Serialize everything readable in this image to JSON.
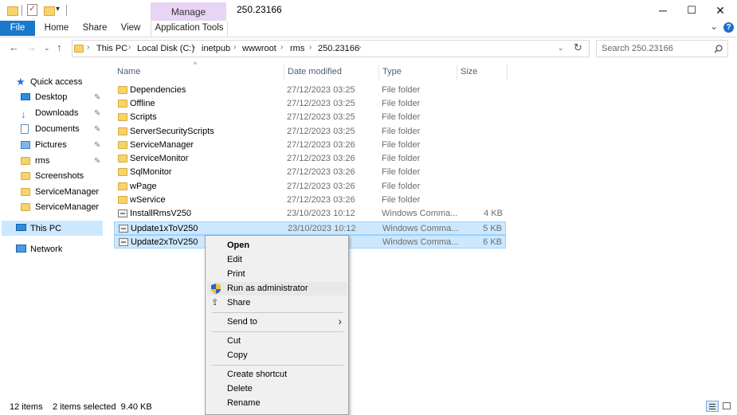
{
  "title_bar": {
    "manage_label": "Manage",
    "window_title": "250.23166",
    "minimize_glyph": "─",
    "maximize_glyph": "☐",
    "close_glyph": "✕"
  },
  "ribbon": {
    "tabs": [
      "File",
      "Home",
      "Share",
      "View",
      "Application Tools"
    ],
    "expand_glyph": "⌄",
    "help_glyph": "?"
  },
  "address_bar": {
    "breadcrumbs": [
      "This PC",
      "Local Disk (C:)",
      "inetpub",
      "wwwroot",
      "rms",
      "250.23166"
    ],
    "search_placeholder": "Search 250.23166"
  },
  "nav_pane": {
    "quick_access": "Quick access",
    "items": [
      {
        "label": "Desktop",
        "icon": "desktop-icon",
        "pinned": true
      },
      {
        "label": "Downloads",
        "icon": "download-icon",
        "pinned": true
      },
      {
        "label": "Documents",
        "icon": "documents-icon",
        "pinned": true
      },
      {
        "label": "Pictures",
        "icon": "pictures-icon",
        "pinned": true
      },
      {
        "label": "rms",
        "icon": "folder-icon",
        "pinned": true
      },
      {
        "label": "Screenshots",
        "icon": "folder-icon",
        "pinned": false
      },
      {
        "label": "ServiceManager",
        "icon": "folder-icon",
        "pinned": false
      },
      {
        "label": "ServiceManager",
        "icon": "folder-icon",
        "pinned": false
      }
    ],
    "this_pc": "This PC",
    "network": "Network",
    "pin_glyph": "📌"
  },
  "file_list": {
    "columns": [
      "Name",
      "Date modified",
      "Type",
      "Size"
    ],
    "rows": [
      {
        "name": "Dependencies",
        "date": "27/12/2023 03:25",
        "type": "File folder",
        "size": "",
        "kind": "folder",
        "selected": false
      },
      {
        "name": "Offline",
        "date": "27/12/2023 03:25",
        "type": "File folder",
        "size": "",
        "kind": "folder",
        "selected": false
      },
      {
        "name": "Scripts",
        "date": "27/12/2023 03:25",
        "type": "File folder",
        "size": "",
        "kind": "folder",
        "selected": false
      },
      {
        "name": "ServerSecurityScripts",
        "date": "27/12/2023 03:25",
        "type": "File folder",
        "size": "",
        "kind": "folder",
        "selected": false
      },
      {
        "name": "ServiceManager",
        "date": "27/12/2023 03:26",
        "type": "File folder",
        "size": "",
        "kind": "folder",
        "selected": false
      },
      {
        "name": "ServiceMonitor",
        "date": "27/12/2023 03:26",
        "type": "File folder",
        "size": "",
        "kind": "folder",
        "selected": false
      },
      {
        "name": "SqlMonitor",
        "date": "27/12/2023 03:26",
        "type": "File folder",
        "size": "",
        "kind": "folder",
        "selected": false
      },
      {
        "name": "wPage",
        "date": "27/12/2023 03:26",
        "type": "File folder",
        "size": "",
        "kind": "folder",
        "selected": false
      },
      {
        "name": "wService",
        "date": "27/12/2023 03:26",
        "type": "File folder",
        "size": "",
        "kind": "folder",
        "selected": false
      },
      {
        "name": "InstallRmsV250",
        "date": "23/10/2023 10:12",
        "type": "Windows Comma...",
        "size": "4 KB",
        "kind": "cmd",
        "selected": false
      },
      {
        "name": "Update1xToV250",
        "date": "23/10/2023 10:12",
        "type": "Windows Comma...",
        "size": "5 KB",
        "kind": "cmd",
        "selected": true
      },
      {
        "name": "Update2xToV250",
        "date": "",
        "type": "Windows Comma...",
        "size": "6 KB",
        "kind": "cmd",
        "selected": true
      }
    ]
  },
  "context_menu": {
    "items": [
      "Open",
      "Edit",
      "Print",
      "Run as administrator",
      "Share",
      "Send to",
      "Cut",
      "Copy",
      "Create shortcut",
      "Delete",
      "Rename"
    ],
    "submenu_glyph": "›"
  },
  "status_bar": {
    "item_count": "12 items",
    "selection": "2 items selected  9.40 KB"
  },
  "colors": {
    "file_tab": "#1979ca",
    "manage_tab": "#e8d4f4",
    "selection_bg": "#cce8ff",
    "selection_border": "#99d1ff",
    "folder": "#f6d36b"
  }
}
